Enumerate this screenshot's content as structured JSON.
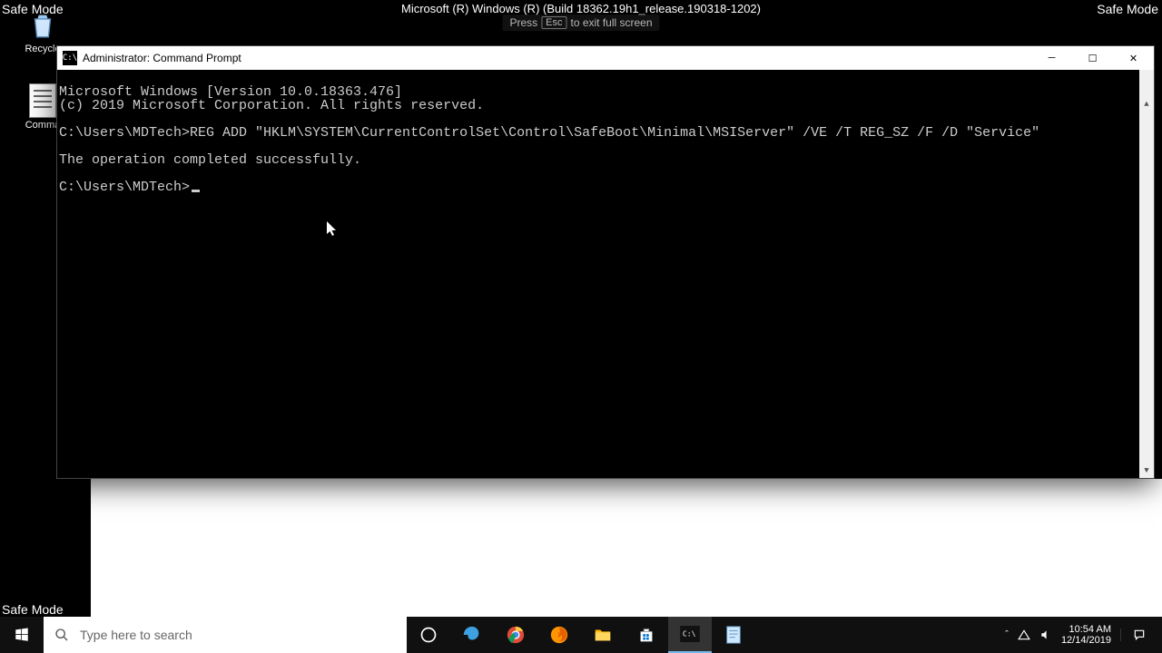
{
  "safe_mode": {
    "top_left": "Safe Mode",
    "top_right": "Safe Mode",
    "bottom_left": "Safe Mode",
    "build": "Microsoft (R) Windows (R) (Build 18362.19h1_release.190318-1202)"
  },
  "fullscreen_hint": {
    "press": "Press",
    "key": "Esc",
    "rest": "to exit full screen"
  },
  "desktop_icons": {
    "recycle": "Recycle",
    "commands": "Comma"
  },
  "cmd": {
    "title": "Administrator: Command Prompt",
    "lines": {
      "l1": "Microsoft Windows [Version 10.0.18363.476]",
      "l2": "(c) 2019 Microsoft Corporation. All rights reserved.",
      "l3": "",
      "l4": "C:\\Users\\MDTech>REG ADD \"HKLM\\SYSTEM\\CurrentControlSet\\Control\\SafeBoot\\Minimal\\MSIServer\" /VE /T REG_SZ /F /D \"Service\"",
      "l5": "",
      "l6": "The operation completed successfully.",
      "l7": "",
      "l8": "C:\\Users\\MDTech>"
    }
  },
  "taskbar": {
    "search_placeholder": "Type here to search",
    "clock_time": "10:54 AM",
    "clock_date": "12/14/2019"
  }
}
